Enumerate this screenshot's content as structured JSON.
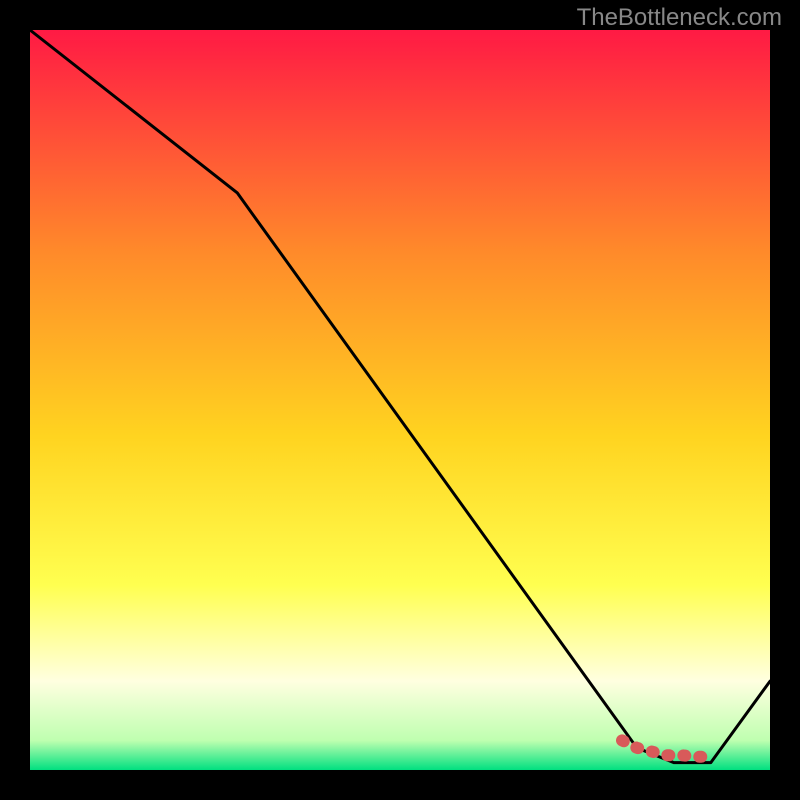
{
  "watermark": "TheBottleneck.com",
  "chart_data": {
    "type": "line",
    "title": "",
    "xlabel": "",
    "ylabel": "",
    "xlim": [
      0,
      100
    ],
    "ylim": [
      0,
      100
    ],
    "background_gradient": {
      "top": "#ff1a44",
      "upper_mid": "#ffa030",
      "mid": "#ffe020",
      "lower_mid": "#ffff50",
      "near_bottom": "#ffffe0",
      "bottom": "#00e080"
    },
    "series": [
      {
        "name": "main-curve",
        "color": "#000000",
        "x": [
          0,
          28,
          82,
          87,
          92,
          100
        ],
        "values": [
          100,
          78,
          3,
          1,
          1,
          12
        ]
      },
      {
        "name": "highlight-segment",
        "color": "#d85a5a",
        "x": [
          80,
          82,
          84,
          86,
          88,
          90,
          92
        ],
        "values": [
          4,
          3,
          2.5,
          2,
          2,
          1.8,
          1.8
        ]
      }
    ]
  }
}
